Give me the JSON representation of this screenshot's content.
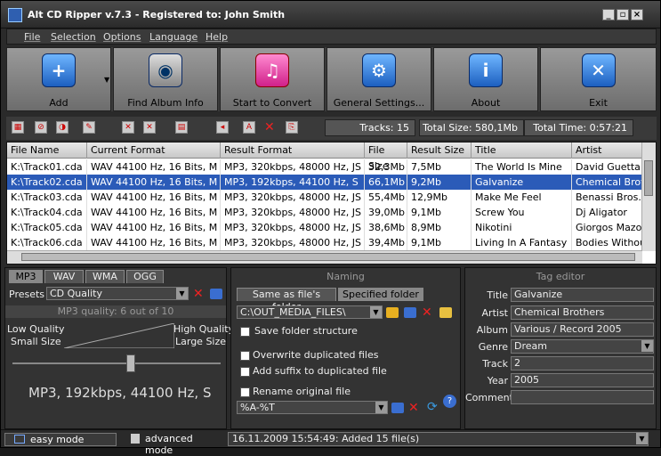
{
  "window": {
    "title": "Alt CD Ripper v.7.3 - Registered to: John Smith",
    "controls": [
      "minimize",
      "maximize",
      "close"
    ]
  },
  "menu": [
    "File",
    "Selection",
    "Options",
    "Language",
    "Help"
  ],
  "bigbuttons": [
    {
      "label": "Add",
      "icon": "add-disc-icon"
    },
    {
      "label": "Find Album Info",
      "icon": "find-album-icon"
    },
    {
      "label": "Start to Convert",
      "icon": "convert-icon"
    },
    {
      "label": "General Settings...",
      "icon": "settings-icon"
    },
    {
      "label": "About",
      "icon": "about-icon"
    },
    {
      "label": "Exit",
      "icon": "exit-icon"
    }
  ],
  "stats": {
    "tracks": "Tracks: 15",
    "total_size": "Total Size: 580,1Mb",
    "total_time": "Total Time: 0:57:21"
  },
  "grid": {
    "headers": [
      "File Name",
      "Current Format",
      "Result Format",
      "File Size",
      "Result Size",
      "Title",
      "Artist"
    ],
    "rows": [
      [
        "K:\\Track01.cda",
        "WAV 44100 Hz, 16 Bits, M",
        "MP3, 320kbps, 48000 Hz, JS",
        "32,3Mb",
        "7,5Mb",
        "The World Is Mine",
        "David Guetta"
      ],
      [
        "K:\\Track02.cda",
        "WAV 44100 Hz, 16 Bits, M",
        "MP3, 192kbps, 44100 Hz, S",
        "66,1Mb",
        "9,2Mb",
        "Galvanize",
        "Chemical Brothe"
      ],
      [
        "K:\\Track03.cda",
        "WAV 44100 Hz, 16 Bits, M",
        "MP3, 320kbps, 48000 Hz, JS",
        "55,4Mb",
        "12,9Mb",
        "Make Me Feel",
        "Benassi Bros. f"
      ],
      [
        "K:\\Track04.cda",
        "WAV 44100 Hz, 16 Bits, M",
        "MP3, 320kbps, 48000 Hz, JS",
        "39,0Mb",
        "9,1Mb",
        "Screw You",
        "Dj Aligator"
      ],
      [
        "K:\\Track05.cda",
        "WAV 44100 Hz, 16 Bits, M",
        "MP3, 320kbps, 48000 Hz, JS",
        "38,6Mb",
        "8,9Mb",
        "Nikotini",
        "Giorgos Mazone"
      ],
      [
        "K:\\Track06.cda",
        "WAV 44100 Hz, 16 Bits, M",
        "MP3, 320kbps, 48000 Hz, JS",
        "39,4Mb",
        "9,1Mb",
        "Living In A Fantasy",
        "Bodies Without C"
      ]
    ],
    "selected_row": 1
  },
  "format_panel": {
    "tabs": [
      "MP3",
      "WAV",
      "WMA",
      "OGG"
    ],
    "active_tab": 0,
    "presets_label": "Presets",
    "preset_value": "CD Quality",
    "quality_text": "MP3 quality: 6 out of 10",
    "low_quality": "Low Quality",
    "small_size": "Small Size",
    "high_quality": "High Quality",
    "large_size": "Large Size",
    "quality_level": 0.6,
    "summary": "MP3, 192kbps, 44100 Hz, S"
  },
  "naming": {
    "header": "Naming",
    "tab_same": "Same as file's folder",
    "tab_specified": "Specified folder",
    "folder": "C:\\OUT_MEDIA_FILES\\",
    "save_structure": "Save folder structure",
    "overwrite": "Overwrite duplicated files",
    "add_suffix": "Add suffix to duplicated file",
    "rename": "Rename original file",
    "rename_pattern": "%A-%T"
  },
  "tag_editor": {
    "header": "Tag editor",
    "fields": [
      {
        "label": "Title",
        "value": "Galvanize"
      },
      {
        "label": "Artist",
        "value": "Chemical Brothers"
      },
      {
        "label": "Album",
        "value": "Various / Record 2005"
      },
      {
        "label": "Genre",
        "value": "Dream"
      },
      {
        "label": "Track",
        "value": "2"
      },
      {
        "label": "Year",
        "value": "2005"
      },
      {
        "label": "Comment",
        "value": ""
      }
    ]
  },
  "status": {
    "easy_mode": "easy mode",
    "advanced_mode": "advanced mode",
    "message": "16.11.2009 15:54:49: Added 15 file(s)"
  }
}
